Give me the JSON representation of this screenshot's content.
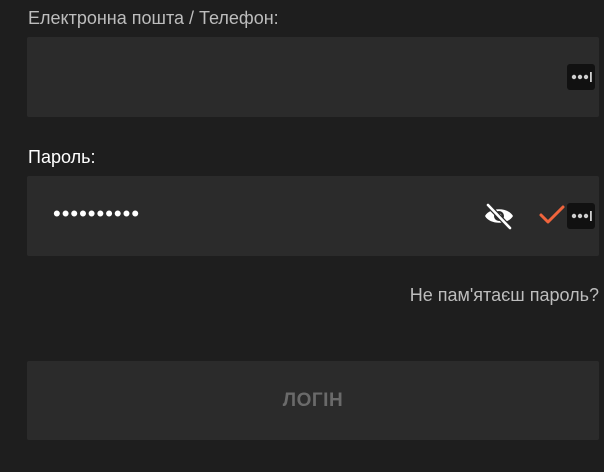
{
  "form": {
    "email_label": "Електронна пошта / Телефон:",
    "email_value": "",
    "password_label": "Пароль:",
    "password_value": "••••••••••",
    "forgot_password": "Не пам'ятаєш пароль?",
    "login_button": "ЛОГІН"
  },
  "icons": {
    "password_manager": "password-manager-icon",
    "toggle_visibility": "eye-slash-icon",
    "valid": "checkmark-icon"
  },
  "colors": {
    "background": "#1e1e1e",
    "field": "#2b2b2b",
    "accent": "#f0643c",
    "muted_text": "#bdbdbd",
    "disabled_text": "#6a6a6a"
  }
}
